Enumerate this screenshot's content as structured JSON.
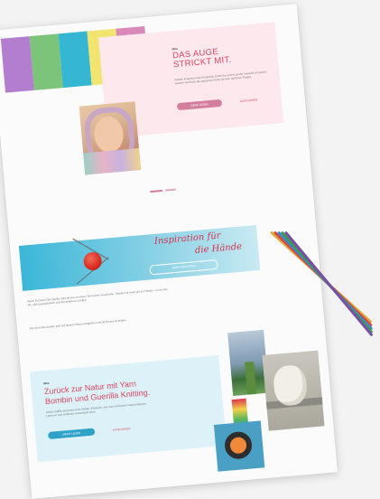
{
  "colors": {
    "accent_pink": "#d9465f",
    "button_pink": "#d27e9c",
    "button_blue": "#2ea2c7",
    "stripes": [
      "#b37ed0",
      "#7cc47a",
      "#35b7d4",
      "#f1e46f",
      "#d889b9"
    ],
    "pencils": [
      "#e0a63a",
      "#d9463f",
      "#3b8bc9",
      "#3c9c4e",
      "#7a4ea8"
    ]
  },
  "hero": {
    "kicker": "Mira",
    "title_line1": "DAS AUGE",
    "title_line2": "STRICKT MIT.",
    "text": "Farben inspirieren die Kreativität. Entdecke unsere große Auswahl an bunten Garnen und finde die passende Farbe für dein nächstes Projekt.",
    "button": "MEHR LESEN",
    "link": "KATEGORIEN"
  },
  "slider": {
    "count": 2,
    "active": 0
  },
  "banner": {
    "script_line1": "Inspiration für",
    "script_line2": "die Hände",
    "button": "MEHR ERFAHREN"
  },
  "body_text": {
    "para1": "Wenn Du Dein Garn kaufst, wird dieses zu einem Teil Deiner Geschichte. Stricken ist mehr als ein Hobby – es ist eine Art, dich auszudrücken und mit anderen zu teilen.",
    "para2": "Wir sind stolz darauf, dich auf diesem Weg zu begleiten und dir Neues zu zeigen."
  },
  "card2": {
    "kicker": "Mira",
    "title_line1": "Zurück zur Natur mit Yarn",
    "title_line2": "Bombin und Guerilla Knitting.",
    "text": "Strick-Graffiti verschönert die Städte. Entdecke, wie man mit bunten Garnen Bäume, Laternen und Geländer verwandeln kann.",
    "button": "MEHR LESEN",
    "link": "KATEGORIEN"
  }
}
